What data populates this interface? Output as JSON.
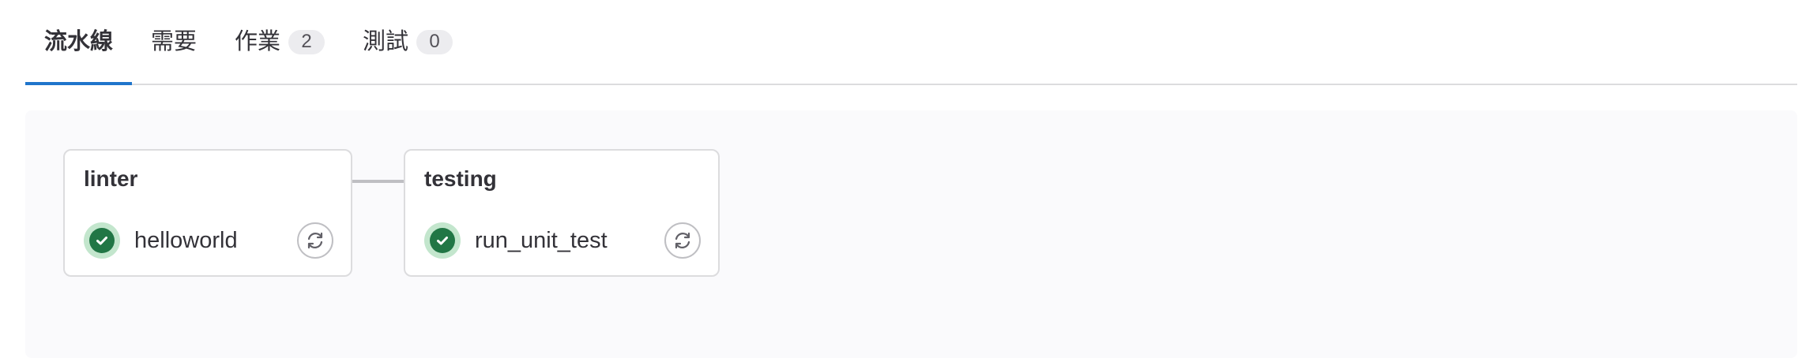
{
  "tabs": [
    {
      "label": "流水線",
      "active": true
    },
    {
      "label": "需要",
      "active": false
    },
    {
      "label": "作業",
      "count": "2",
      "active": false
    },
    {
      "label": "測試",
      "count": "0",
      "active": false
    }
  ],
  "stages": [
    {
      "title": "linter",
      "jobs": [
        {
          "name": "helloworld",
          "status": "success",
          "status_icon": "check-circle-icon",
          "action_icon": "retry-icon"
        }
      ]
    },
    {
      "title": "testing",
      "jobs": [
        {
          "name": "run_unit_test",
          "status": "success",
          "status_icon": "check-circle-icon",
          "action_icon": "retry-icon"
        }
      ]
    }
  ],
  "colors": {
    "active_tab_underline": "#1f75cb",
    "success": "#217645",
    "success_halo": "#c3e6cd"
  }
}
